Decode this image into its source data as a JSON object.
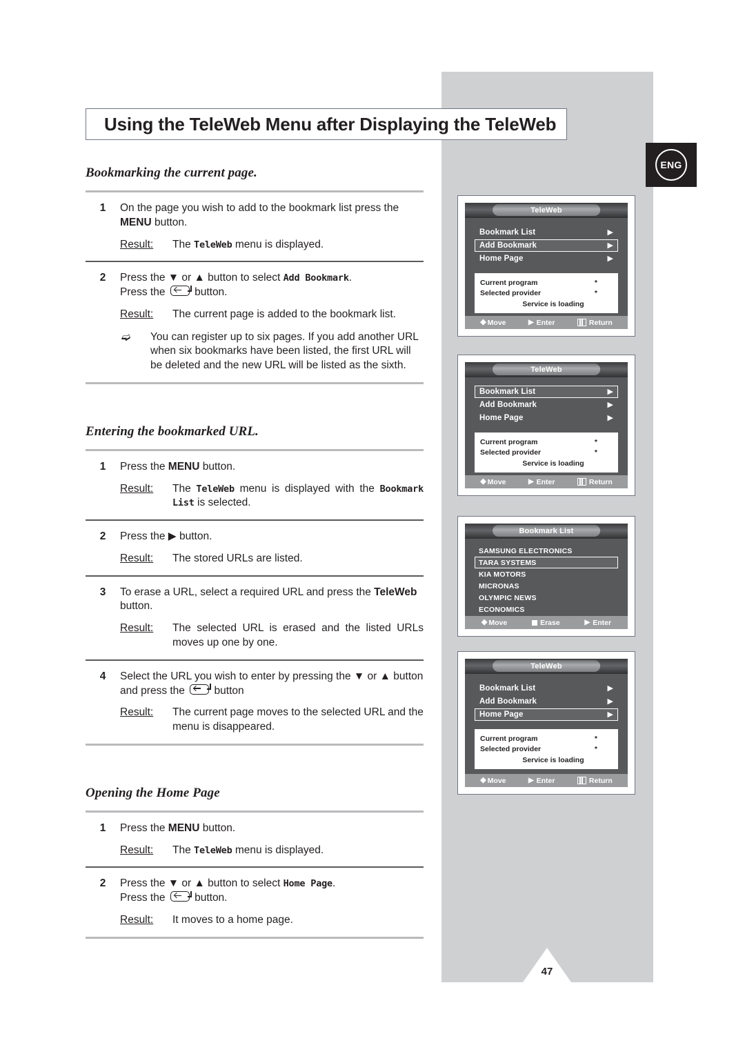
{
  "page": {
    "title": "Using the TeleWeb Menu after Displaying the TeleWeb",
    "number": "47",
    "lang_badge": "ENG"
  },
  "sections": [
    {
      "heading": "Bookmarking the current page.",
      "steps": [
        {
          "num": "1",
          "line1_a": "On the page you wish to add to the bookmark list press the ",
          "line1_b": "MENU",
          "line1_c": " button.",
          "result_label": "Result:",
          "result_a": "The ",
          "result_mono": "TeleWeb",
          "result_b": " menu is displayed."
        },
        {
          "num": "2",
          "line1_a": "Press the ",
          "line1_dn": "▼",
          "line1_b": " or ",
          "line1_up": "▲",
          "line1_c": " button to select ",
          "line1_mono": "Add Bookmark",
          "line1_d": ".",
          "line2_a": "Press the ",
          "line2_b": " button.",
          "result_label": "Result:",
          "result_text": "The current page is added to the bookmark list.",
          "note": "You can register up to six pages. If you add another URL when six bookmarks have been listed, the first URL will be deleted and the new URL will be listed as the sixth."
        }
      ]
    },
    {
      "heading": "Entering the bookmarked URL.",
      "steps": [
        {
          "num": "1",
          "line1_a": "Press the ",
          "line1_b": "MENU",
          "line1_c": " button.",
          "result_label": "Result:",
          "result_a": "The ",
          "result_mono1": "TeleWeb",
          "result_b": " menu is displayed with the ",
          "result_mono2": "Bookmark List",
          "result_c": " is selected."
        },
        {
          "num": "2",
          "line1_a": "Press the ",
          "line1_arrow": "▶",
          "line1_b": " button.",
          "result_label": "Result:",
          "result_text": "The stored URLs are listed."
        },
        {
          "num": "3",
          "line1_a": "To erase a URL, select a required URL and press the ",
          "line1_b": "TeleWeb",
          "line1_c": " button.",
          "result_label": "Result:",
          "result_text": "The selected URL is erased and the listed URLs moves up one by one."
        },
        {
          "num": "4",
          "line1_a": "Select the URL you wish to enter by pressing the ",
          "line1_dn": "▼",
          "line1_b": " or ",
          "line1_up": "▲",
          "line1_c": " button",
          "line2_a": "and press the ",
          "line2_b": " button",
          "result_label": "Result:",
          "result_text": "The current page moves to the selected URL and the menu is disappeared."
        }
      ]
    },
    {
      "heading": "Opening the Home Page",
      "steps": [
        {
          "num": "1",
          "line1_a": "Press the ",
          "line1_b": "MENU",
          "line1_c": " button.",
          "result_label": "Result:",
          "result_a": "The ",
          "result_mono": "TeleWeb",
          "result_b": " menu is displayed."
        },
        {
          "num": "2",
          "line1_a": "Press the ",
          "line1_dn": "▼",
          "line1_b": " or ",
          "line1_up": "▲",
          "line1_c": " button to select ",
          "line1_mono": "Home Page",
          "line1_d": ".",
          "line2_a": "Press the ",
          "line2_b": " button.",
          "result_label": "Result:",
          "result_text": "It moves to a home page."
        }
      ]
    }
  ],
  "screens": [
    {
      "id": "teleweb-add-bookmark",
      "title": "TeleWeb",
      "menu": [
        {
          "label": "Bookmark List",
          "arrow": "▶",
          "selected": false
        },
        {
          "label": "Add Bookmark",
          "arrow": "▶",
          "selected": true
        },
        {
          "label": "Home Page",
          "arrow": "▶",
          "selected": false
        }
      ],
      "info": {
        "current_program_label": "Current program",
        "current_program_value": "*",
        "selected_provider_label": "Selected provider",
        "selected_provider_value": "*",
        "status": "Service is loading"
      },
      "nav": [
        {
          "icon": "updown",
          "label": "Move"
        },
        {
          "icon": "right",
          "label": "Enter"
        },
        {
          "icon": "bars",
          "label": "Return"
        }
      ]
    },
    {
      "id": "teleweb-bookmark-list",
      "title": "TeleWeb",
      "menu": [
        {
          "label": "Bookmark List",
          "arrow": "▶",
          "selected": true
        },
        {
          "label": "Add Bookmark",
          "arrow": "▶",
          "selected": false
        },
        {
          "label": "Home Page",
          "arrow": "▶",
          "selected": false
        }
      ],
      "info": {
        "current_program_label": "Current program",
        "current_program_value": "*",
        "selected_provider_label": "Selected provider",
        "selected_provider_value": "*",
        "status": "Service is loading"
      },
      "nav": [
        {
          "icon": "updown",
          "label": "Move"
        },
        {
          "icon": "right",
          "label": "Enter"
        },
        {
          "icon": "bars",
          "label": "Return"
        }
      ]
    },
    {
      "id": "bookmark-list-urls",
      "title": "Bookmark List",
      "urls": [
        {
          "label": "SAMSUNG ELECTRONICS",
          "selected": false
        },
        {
          "label": "TARA SYSTEMS",
          "selected": true
        },
        {
          "label": "KIA MOTORS",
          "selected": false
        },
        {
          "label": "MICRONAS",
          "selected": false
        },
        {
          "label": "OLYMPIC NEWS",
          "selected": false
        },
        {
          "label": "ECONOMICS",
          "selected": false
        }
      ],
      "nav": [
        {
          "icon": "updown",
          "label": "Move"
        },
        {
          "icon": "square",
          "label": "Erase"
        },
        {
          "icon": "right",
          "label": "Enter"
        }
      ]
    },
    {
      "id": "teleweb-home-page",
      "title": "TeleWeb",
      "menu": [
        {
          "label": "Bookmark List",
          "arrow": "▶",
          "selected": false
        },
        {
          "label": "Add Bookmark",
          "arrow": "▶",
          "selected": false
        },
        {
          "label": "Home Page",
          "arrow": "▶",
          "selected": true
        }
      ],
      "info": {
        "current_program_label": "Current program",
        "current_program_value": "*",
        "selected_provider_label": "Selected provider",
        "selected_provider_value": "*",
        "status": "Service is loading"
      },
      "nav": [
        {
          "icon": "updown",
          "label": "Move"
        },
        {
          "icon": "right",
          "label": "Enter"
        },
        {
          "icon": "bars",
          "label": "Return"
        }
      ]
    }
  ],
  "colors": {
    "band": "#cfd0d2",
    "badge_bg": "#231f20",
    "screen_bg": "#58595b",
    "navbar_bg": "#9b9c9e"
  }
}
